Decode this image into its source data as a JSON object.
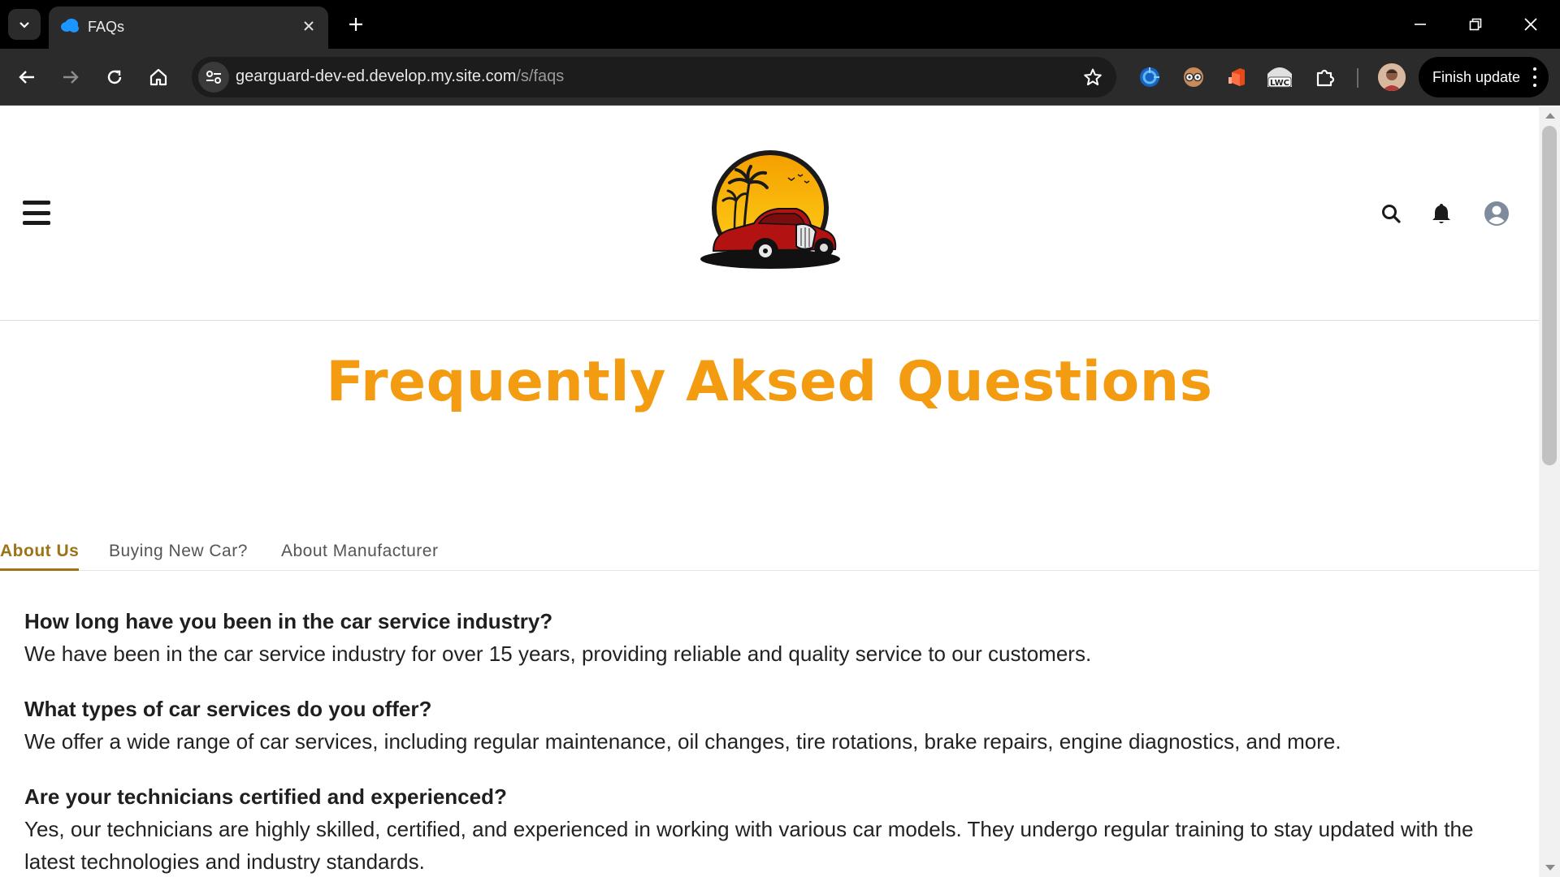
{
  "browser": {
    "tab_title": "FAQs",
    "url_host": "gearguard-dev-ed.develop.my.site.com",
    "url_path": "/s/faqs",
    "finish_update_label": "Finish update",
    "extensions": [
      "salesforce-inspector-icon",
      "glasses-extension-icon",
      "office-extension-icon",
      "lwc-extension-icon",
      "puzzle-extensions-icon"
    ]
  },
  "site": {
    "logo_alt": "car-sunset-logo",
    "heading": "Frequently Aksed Questions",
    "tabs": [
      "About Us",
      "Buying New Car?",
      "About Manufacturer"
    ],
    "active_tab": "About Us",
    "faqs": [
      {
        "question": "How long have you been in the car service industry?",
        "answer": "We have been in the car service industry for over 15 years, providing reliable and quality service to our customers."
      },
      {
        "question": "What types of car services do you offer?",
        "answer": "We offer a wide range of car services, including regular maintenance, oil changes, tire rotations, brake repairs, engine diagnostics, and more."
      },
      {
        "question": "Are your technicians certified and experienced?",
        "answer": "Yes, our technicians are highly skilled, certified, and experienced in working with various car models. They undergo regular training to stay updated with the latest technologies and industry standards."
      }
    ]
  },
  "colors": {
    "heading": "#f39c12",
    "active_tab": "#9a7417"
  }
}
